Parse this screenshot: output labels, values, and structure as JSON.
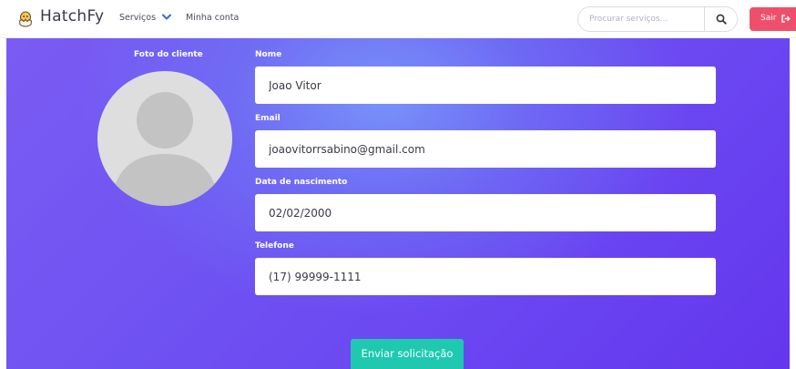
{
  "navbar": {
    "brand": "HatchFy",
    "services_label": "Serviços",
    "account_label": "Minha conta",
    "search_placeholder": "Procurar serviços...",
    "logout_label": "Sair"
  },
  "profile": {
    "photo_label": "Foto do cliente"
  },
  "form": {
    "name_label": "Nome",
    "name_value": "Joao Vitor",
    "email_label": "Email",
    "email_value": "joaovitorrsabino@gmail.com",
    "birth_label": "Data de nascimento",
    "birth_value": "02/02/2000",
    "phone_label": "Telefone",
    "phone_value": "(17) 99999-1111",
    "submit_label": "Enviar solicitação"
  },
  "icons": {
    "logo": "chick-egg-icon",
    "services_dropdown": "chevron-down-icon",
    "search": "search-icon",
    "logout": "sign-out-icon",
    "avatar": "user-avatar-icon"
  },
  "colors": {
    "accent_logout": "#ef4f6a",
    "accent_submit": "#1ec9b0",
    "chevron": "#2f6fd8",
    "hero_gradient_start": "#7a5cf3",
    "hero_gradient_end": "#6436ee"
  }
}
